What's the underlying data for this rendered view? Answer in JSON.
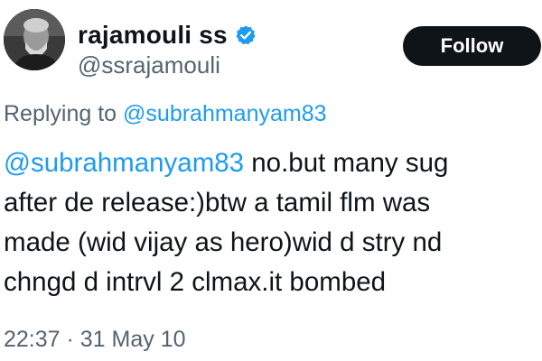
{
  "author": {
    "display_name": "rajamouli ss",
    "handle": "@ssrajamouli",
    "verified_icon": "verified-badge-icon",
    "avatar_icon": "profile-photo"
  },
  "follow_button": {
    "label": "Follow"
  },
  "reply_context": {
    "prefix": "Replying to ",
    "mention": "@subrahmanyam83"
  },
  "tweet": {
    "mention": "@subrahmanyam83",
    "line1_rest": " no.but many sug",
    "line2": "after de release:)btw a tamil flm was",
    "line3": "made (wid vijay as hero)wid d stry nd",
    "line4": "chngd d intrvl 2 clmax.it bombed"
  },
  "timestamp": "22:37 · 31 May 10",
  "colors": {
    "link_blue": "#1d9bf0",
    "text": "#0f1419",
    "muted": "#536471",
    "follow_bg": "#0f1419"
  }
}
